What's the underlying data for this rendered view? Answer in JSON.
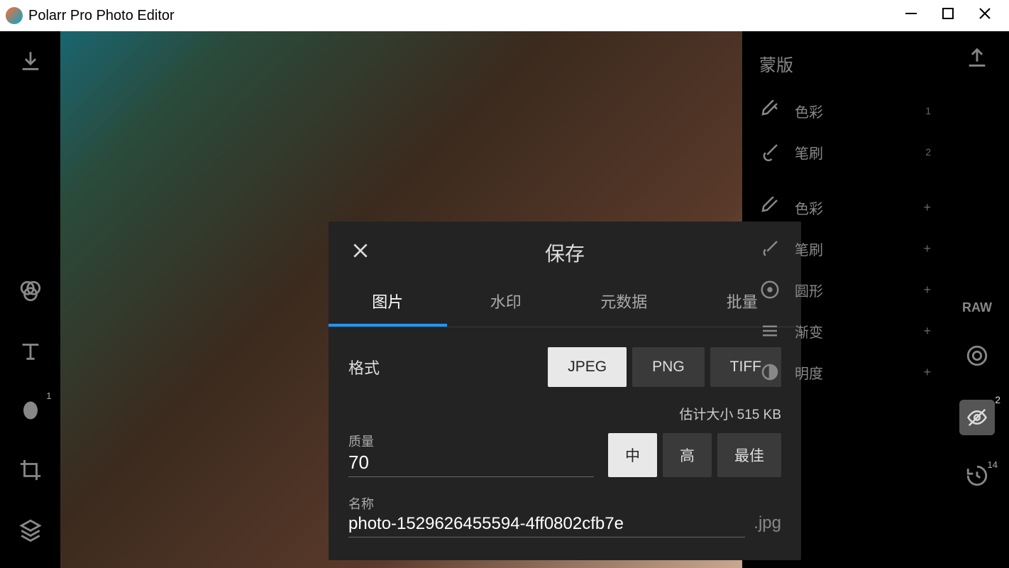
{
  "titlebar": {
    "app_title": "Polarr Pro Photo Editor"
  },
  "right_panel": {
    "title": "蒙版",
    "items_top": [
      {
        "label": "色彩",
        "num": "1"
      },
      {
        "label": "笔刷",
        "num": "2"
      }
    ],
    "items_bottom": [
      {
        "label": "色彩"
      },
      {
        "label": "笔刷"
      },
      {
        "label": "圆形"
      },
      {
        "label": "渐变"
      },
      {
        "label": "明度"
      }
    ]
  },
  "far_right": {
    "raw": "RAW",
    "visibility_badge": "2",
    "history_badge": "14"
  },
  "left_sidebar": {
    "face_badge": "1"
  },
  "modal": {
    "title": "保存",
    "tabs": [
      "图片",
      "水印",
      "元数据",
      "批量"
    ],
    "format_label": "格式",
    "format_options": [
      "JPEG",
      "PNG",
      "TIFF"
    ],
    "size_estimate": "估计大小 515 KB",
    "quality_label": "质量",
    "quality_value": "70",
    "quality_options": [
      "中",
      "高",
      "最佳"
    ],
    "name_label": "名称",
    "name_value": "photo-1529626455594-4ff0802cfb7e",
    "extension": ".jpg"
  }
}
